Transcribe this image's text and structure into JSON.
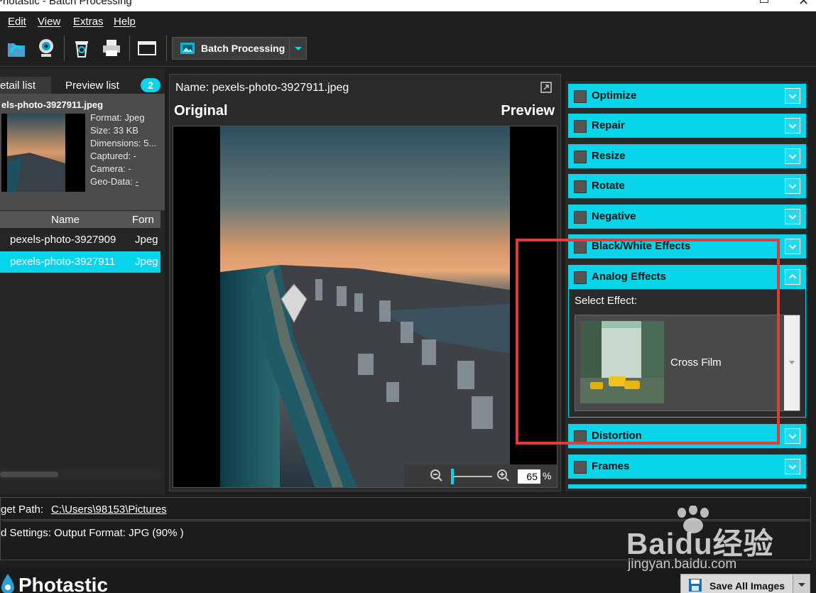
{
  "window": {
    "title": "Photastic - Batch Processing"
  },
  "menu": {
    "items": [
      "Edit",
      "View",
      "Extras",
      "Help"
    ]
  },
  "toolbar": {
    "mode_label": "Batch Processing"
  },
  "left_panel": {
    "tab_detail": "etail list",
    "tab_preview": "Preview list",
    "count": "2",
    "selected_name": "els-photo-3927911.jpeg",
    "meta": {
      "format": "Format: Jpeg",
      "size": "Size: 33 KB",
      "dimensions": "Dimensions: 5...",
      "captured": "Captured: -",
      "camera": "Camera: -",
      "geo_label": "Geo-Data:",
      "geo_value": "-"
    },
    "columns": {
      "name": "Name",
      "format": "Forn"
    },
    "rows": [
      {
        "name": "pexels-photo-3927909",
        "format": "Jpeg"
      },
      {
        "name": "pexels-photo-3927911",
        "format": "Jpeg"
      }
    ]
  },
  "center": {
    "name_label": "Name: pexels-photo-3927911.jpeg",
    "original_label": "Original",
    "preview_label": "Preview",
    "zoom": "65",
    "zoom_unit": "%"
  },
  "right_panel": {
    "sections": [
      "Optimize",
      "Repair",
      "Resize",
      "Rotate",
      "Negative",
      "Black/White Effects",
      "Analog Effects"
    ],
    "select_effect_label": "Select Effect:",
    "selected_effect": "Cross Film",
    "sections_after": [
      "Distortion",
      "Frames"
    ]
  },
  "bottom": {
    "target_label": "get Path:",
    "target_path": "C:\\Users\\98153\\Pictures",
    "settings_text": "d Settings: Output Format: JPG (90% )"
  },
  "footer": {
    "logo": "Photastic",
    "save_label": "Save All Images"
  },
  "watermark": {
    "big": "Baidu经验",
    "small": "jingyan.baidu.com"
  },
  "colors": {
    "accent": "#08d5ea",
    "highlight": "#e53a35",
    "background": "#1e1e1e"
  }
}
